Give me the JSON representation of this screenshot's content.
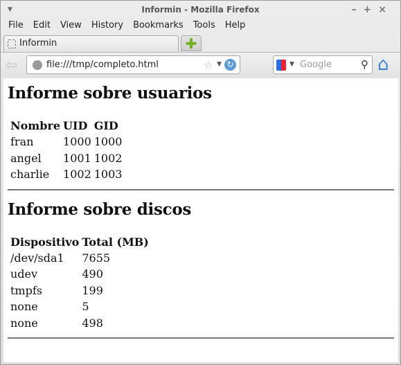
{
  "window": {
    "title": "Informin - Mozilla Firefox"
  },
  "menu": [
    "File",
    "Edit",
    "View",
    "History",
    "Bookmarks",
    "Tools",
    "Help"
  ],
  "tab": {
    "label": "Informin"
  },
  "navbar": {
    "url": "file:///tmp/completo.html",
    "search_placeholder": "Google"
  },
  "users": {
    "title": "Informe sobre usuarios",
    "headers": [
      "Nombre",
      "UID",
      "GID"
    ],
    "rows": [
      [
        "fran",
        "1000",
        "1000"
      ],
      [
        "angel",
        "1001",
        "1002"
      ],
      [
        "charlie",
        "1002",
        "1003"
      ]
    ]
  },
  "disks": {
    "title": "Informe sobre discos",
    "headers": [
      "Dispositivo",
      "Total (MB)"
    ],
    "rows": [
      [
        "/dev/sda1",
        "7655"
      ],
      [
        "udev",
        "490"
      ],
      [
        "tmpfs",
        "199"
      ],
      [
        "none",
        "5"
      ],
      [
        "none",
        "498"
      ]
    ]
  }
}
